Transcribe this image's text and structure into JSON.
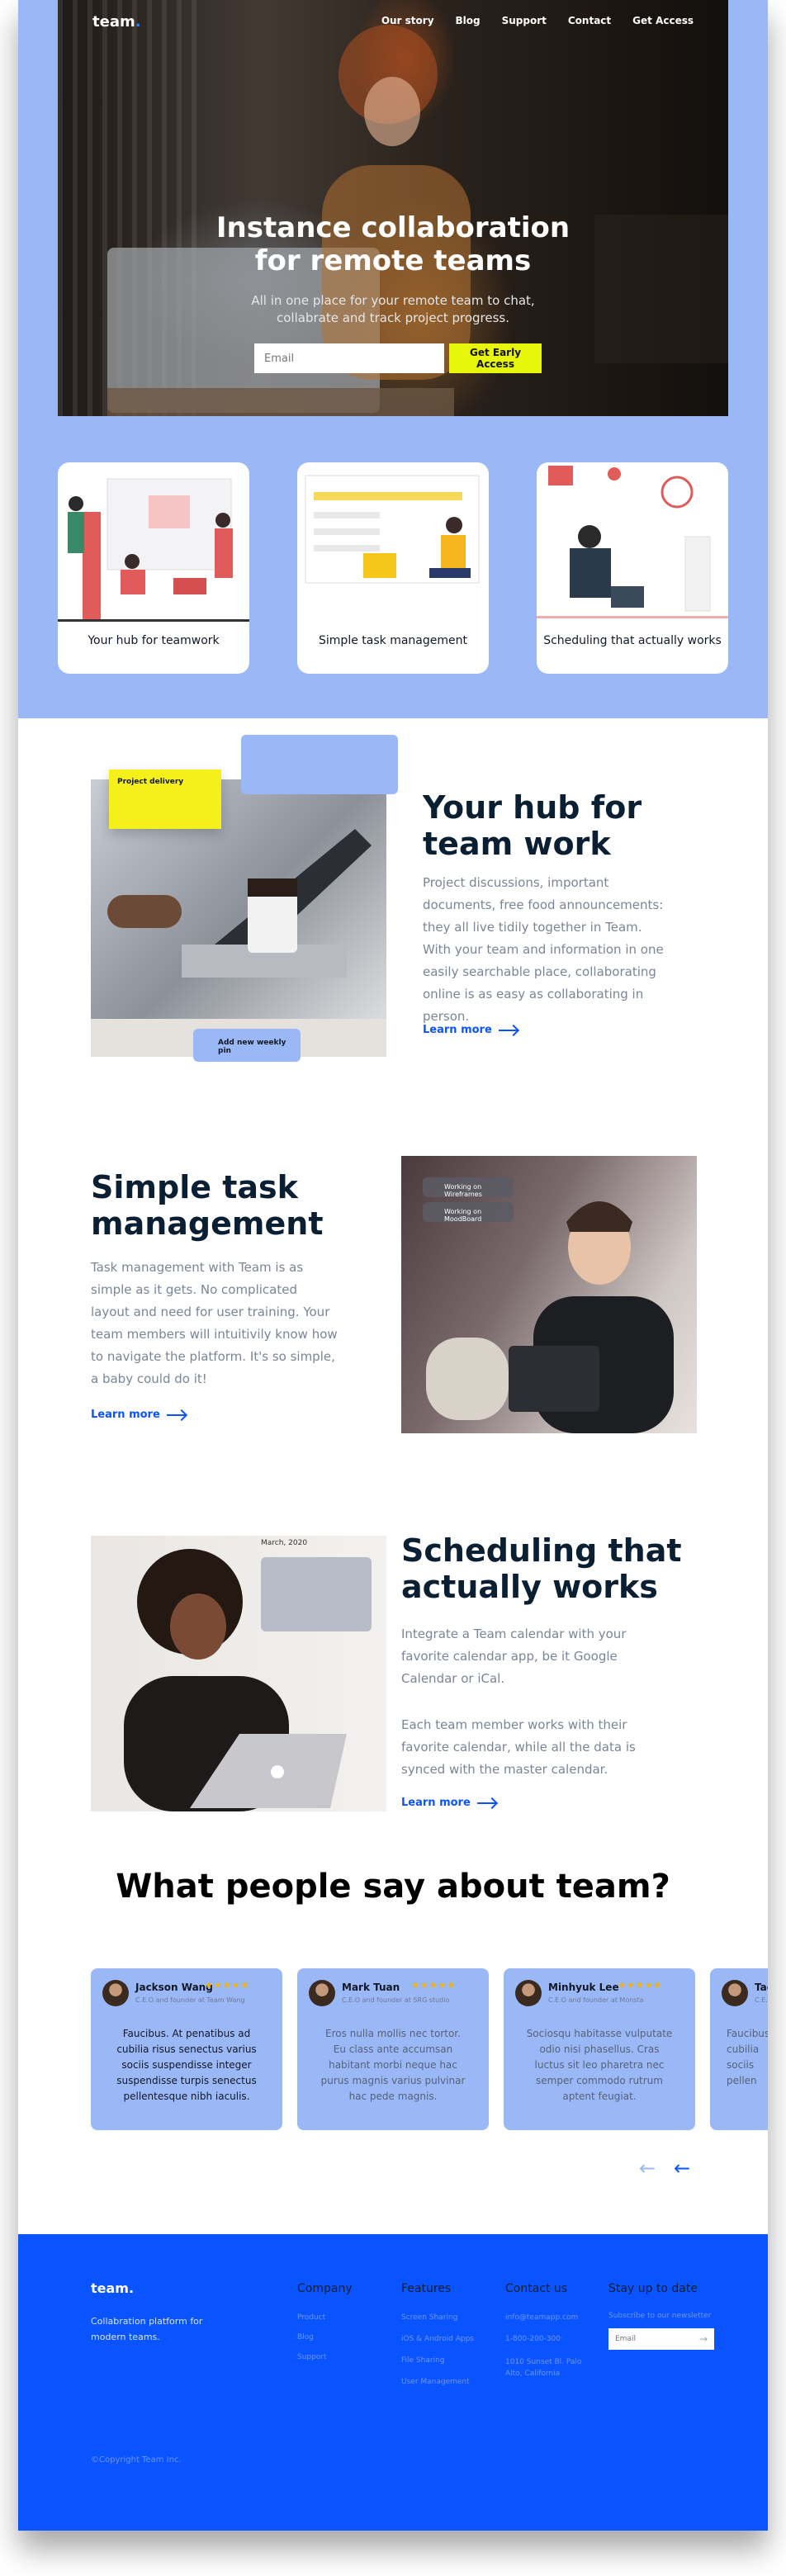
{
  "nav": {
    "logo": "team",
    "logo_dot": ".",
    "links": [
      "Our story",
      "Blog",
      "Support",
      "Contact",
      "Get Access"
    ]
  },
  "hero": {
    "title": "Instance collaboration for remote teams",
    "subtitle": "All in one place for your remote team to chat, collabrate and track project progress.",
    "email_placeholder": "Email",
    "cta": "Get Early Access"
  },
  "cards": [
    {
      "label": "Your hub for teamwork",
      "icon": "team-illustration"
    },
    {
      "label": "Simple task management",
      "icon": "task-illustration"
    },
    {
      "label": "Scheduling that actually works",
      "icon": "schedule-illustration"
    }
  ],
  "features": {
    "hub": {
      "title": "Your hub for team work",
      "body": "Project discussions, important documents, free food announcements: they all live tidily together in Team. With your team and information in one easily searchable place, collaborating online is as easy as collaborating in person.",
      "link": "Learn more",
      "overlay_note": "Project delivery",
      "overlay_task": "Add new weekly pin"
    },
    "task": {
      "title": "Simple task management",
      "body": "Task management with Team is as simple as it gets. No complicated layout and need for user training. Your team members will intuitivily know how to navigate the platform. It's so simple, a baby could do it!",
      "link": "Learn more",
      "chip1": "Working on Wireframes",
      "chip2": "Working on MoodBoard"
    },
    "schedule": {
      "title": "Scheduling that actually works",
      "body1": "Integrate a Team calendar with your favorite calendar app, be it Google Calendar or iCal.",
      "body2": "Each team member works with their favorite calendar, while all the data is synced with the master calendar.",
      "link": "Learn more",
      "calendar_month": "March, 2020"
    }
  },
  "testimonials": {
    "title": "What people say about team?",
    "items": [
      {
        "name": "Jackson Wang",
        "role": "C.E.O and founder at Team Wang",
        "text": "Faucibus. At penatibus ad cubilia risus senectus varius sociis suspendisse integer suspendisse turpis senectus pellentesque nibh iaculis."
      },
      {
        "name": "Mark Tuan",
        "role": "C.E.O and founder at SRG studio",
        "text": "Eros nulla mollis nec tortor. Eu class ante accumsan habitant morbi neque hac purus magnis varius pulvinar hac pede magnis."
      },
      {
        "name": "Minhyuk Lee",
        "role": "C.E.O and founder at Monsta",
        "text": "Sociosqu habitasse vulputate odio nisi phasellus. Cras luctus sit leo pharetra nec semper commodo rutrum aptent feugiat."
      },
      {
        "name": "Taeyong",
        "role": "C.E.O",
        "text": "Faucibus cubilia sociis pellen"
      }
    ],
    "stars": "★★★★★",
    "prev": "←",
    "next": "←"
  },
  "footer": {
    "logo": "team.",
    "tagline": "Collabration platform for modern teams.",
    "company": {
      "title": "Company",
      "links": [
        "Product",
        "Blog",
        "Support"
      ]
    },
    "features": {
      "title": "Features",
      "links": [
        "Screen Sharing",
        "iOS & Android Apps",
        "File Sharing",
        "User Management"
      ]
    },
    "contact": {
      "title": "Contact us",
      "links": [
        "info@teamapp.com",
        "1-800-200-300",
        "1010 Sunset Bl. Palo Alto, California"
      ]
    },
    "newsletter": {
      "title": "Stay up to date",
      "subtitle": "Subscribe to our newsletter",
      "placeholder": "Email",
      "button": "→"
    },
    "copyright": "©Copyright Team Inc."
  },
  "colors": {
    "brand_blue": "#0a54ff",
    "light_blue": "#9bb8f6",
    "accent_yellow": "#e8f60a",
    "dark_text": "#0b1f33"
  }
}
